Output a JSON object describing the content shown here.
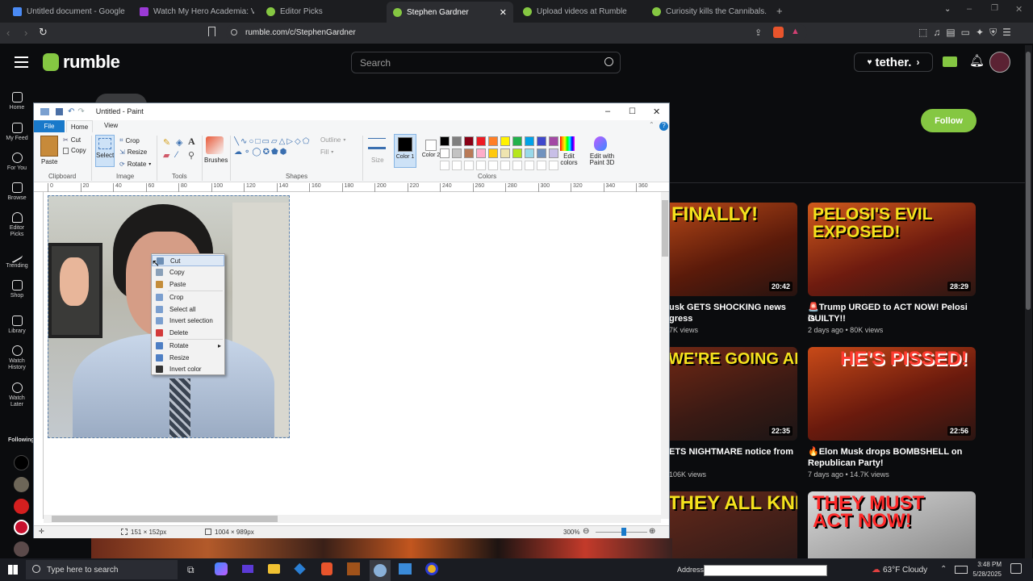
{
  "browser": {
    "tabs": [
      {
        "label": "Untitled document - Google Docs",
        "color": "#4a8af4"
      },
      {
        "label": "Watch My Hero Academia: Vigilants",
        "color": "#9b3ad6"
      },
      {
        "label": "Editor Picks",
        "color": "#85c742"
      },
      {
        "label": "Stephen Gardner",
        "color": "#85c742"
      },
      {
        "label": "Upload videos at Rumble",
        "color": "#85c742"
      },
      {
        "label": "Curiosity kills the Cannibals.",
        "color": "#85c742"
      }
    ],
    "url": "rumble.com/c/StephenGardner"
  },
  "rumble": {
    "logo": "rumble",
    "search_placeholder": "Search",
    "tether": "tether.",
    "follow": "Follow",
    "sidebar": [
      {
        "label": "Home"
      },
      {
        "label": "My Feed"
      },
      {
        "label": "For You"
      },
      {
        "label": "Browse"
      },
      {
        "label": "Editor Picks"
      },
      {
        "label": "Trending"
      },
      {
        "label": "Shop"
      },
      {
        "label": "Library"
      },
      {
        "label": "Watch History"
      },
      {
        "label": "Watch Later"
      }
    ],
    "following": "Following",
    "videos": [
      {
        "thumb": "FINALLY!",
        "duration": "20:42",
        "title": "usk GETS SHOCKING news",
        "title2": "gress",
        "meta": "7K views"
      },
      {
        "thumb": "PELOSI'S EVIL EXPOSED!",
        "duration": "28:29",
        "title": "🚨Trump URGED to ACT NOW! Pelosi is",
        "title2": "GUILTY!!",
        "meta": "2 days ago • 80K views"
      },
      {
        "thumb": "WE'RE GOING AFTER THEM ALL!",
        "duration": "22:35",
        "title": "ETS NIGHTMARE notice from",
        "title2": "",
        "meta": "106K views"
      },
      {
        "thumb": "HE'S PISSED!",
        "duration": "22:56",
        "title": "🔥Elon Musk drops BOMBSHELL on",
        "title2": "Republican Party!",
        "meta": "7 days ago • 14.7K views"
      },
      {
        "thumb": "THEY ALL KNEW!",
        "duration": "",
        "title": "",
        "title2": "",
        "meta": ""
      },
      {
        "thumb": "THEY MUST ACT NOW!",
        "duration": "",
        "title": "",
        "title2": "",
        "meta": ""
      }
    ]
  },
  "paint": {
    "title": "Untitled - Paint",
    "menu": [
      "File",
      "Home",
      "View"
    ],
    "clipboard": {
      "paste": "Paste",
      "cut": "Cut",
      "copy": "Copy",
      "group": "Clipboard"
    },
    "image": {
      "select": "Select",
      "crop": "Crop",
      "resize": "Resize",
      "rotate": "Rotate",
      "group": "Image"
    },
    "tools_group": "Tools",
    "brushes": "Brushes",
    "shapes": {
      "outline": "Outline",
      "fill": "Fill",
      "group": "Shapes"
    },
    "size": "Size",
    "color1": "Color 1",
    "color2": "Color 2",
    "colors_group": "Colors",
    "edit_colors": "Edit colors",
    "edit_3d": "Edit with Paint 3D",
    "palette": [
      "#000000",
      "#7f7f7f",
      "#880015",
      "#ed1c24",
      "#ff7f27",
      "#fff200",
      "#22b14c",
      "#00a2e8",
      "#3f48cc",
      "#a349a4",
      "#ffffff",
      "#c3c3c3",
      "#b97a57",
      "#ffaec9",
      "#ffc90e",
      "#efe4b0",
      "#b5e61d",
      "#99d9ea",
      "#7092be",
      "#c8bfe7"
    ],
    "ruler": [
      "0",
      "20",
      "40",
      "60",
      "80",
      "100",
      "120",
      "140",
      "160",
      "180",
      "200",
      "220",
      "240",
      "260",
      "280",
      "300",
      "320",
      "340",
      "360"
    ],
    "status_selection": "151 × 152px",
    "status_size": "1004 × 989px",
    "zoom": "300%"
  },
  "context_menu": [
    {
      "label": "Cut",
      "color": "#6e8fb5",
      "sep_after": false
    },
    {
      "label": "Copy",
      "color": "#8aa0b8",
      "sep_after": false
    },
    {
      "label": "Paste",
      "color": "#c48d3a",
      "sep_after": true
    },
    {
      "label": "Crop",
      "color": "#7b9fcf",
      "sep_after": false
    },
    {
      "label": "Select all",
      "color": "#7b9fcf",
      "sep_after": false
    },
    {
      "label": "Invert selection",
      "color": "#7b9fcf",
      "sep_after": false
    },
    {
      "label": "Delete",
      "color": "#d33a3a",
      "sep_after": true
    },
    {
      "label": "Rotate",
      "color": "#4e7fc4",
      "sep_after": false
    },
    {
      "label": "Resize",
      "color": "#4e7fc4",
      "sep_after": false
    },
    {
      "label": "Invert color",
      "color": "#333333",
      "sep_after": false
    }
  ],
  "taskbar": {
    "search_placeholder": "Type here to search",
    "address_label": "Address",
    "weather": "63°F  Cloudy",
    "time": "3:48 PM",
    "date": "5/28/2025"
  }
}
